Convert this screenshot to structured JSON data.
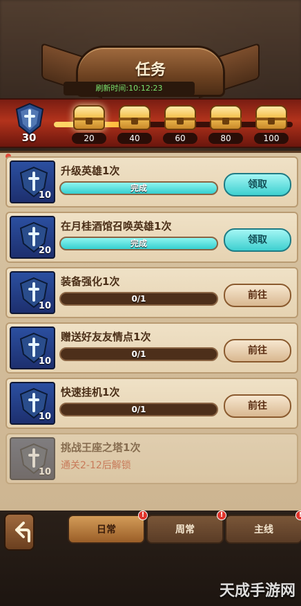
{
  "window": {
    "title": "任务",
    "refresh_time": "刷新时间:10:12:23"
  },
  "progress": {
    "current": 30,
    "max": 100,
    "milestones": [
      20,
      40,
      60,
      80,
      100
    ]
  },
  "missions": [
    {
      "name": "升级英雄1次",
      "level": "10",
      "status_text": "完成",
      "progress_fraction": 1.0,
      "button": "领取",
      "button_type": "claim",
      "locked": false
    },
    {
      "name": "在月桂酒馆召唤英雄1次",
      "level": "20",
      "status_text": "完成",
      "progress_fraction": 1.0,
      "button": "领取",
      "button_type": "claim",
      "locked": false
    },
    {
      "name": "装备强化1次",
      "level": "10",
      "status_text": "0/1",
      "progress_fraction": 0.0,
      "button": "前往",
      "button_type": "go",
      "locked": false
    },
    {
      "name": "赠送好友友情点1次",
      "level": "10",
      "status_text": "0/1",
      "progress_fraction": 0.0,
      "button": "前往",
      "button_type": "go",
      "locked": false
    },
    {
      "name": "快速挂机1次",
      "level": "10",
      "status_text": "0/1",
      "progress_fraction": 0.0,
      "button": "前往",
      "button_type": "go",
      "locked": false
    },
    {
      "name": "挑战王座之塔1次",
      "level": "10",
      "status_text": "通关2-12后解锁",
      "progress_fraction": null,
      "button": "",
      "button_type": "none",
      "locked": true
    }
  ],
  "tabs": [
    {
      "label": "日常",
      "active": true,
      "badge": "!"
    },
    {
      "label": "周常",
      "active": false,
      "badge": "!"
    },
    {
      "label": "主线",
      "active": false,
      "badge": "!"
    }
  ],
  "watermark": "天成手游网",
  "colors": {
    "accent_cyan": "#3ed0d0",
    "panel_bg": "#d8c4a3",
    "red_band": "#b3331c"
  },
  "icons": {
    "back": "back-arrow-icon",
    "shield": "shield-sword-icon",
    "chest": "treasure-chest-icon"
  }
}
